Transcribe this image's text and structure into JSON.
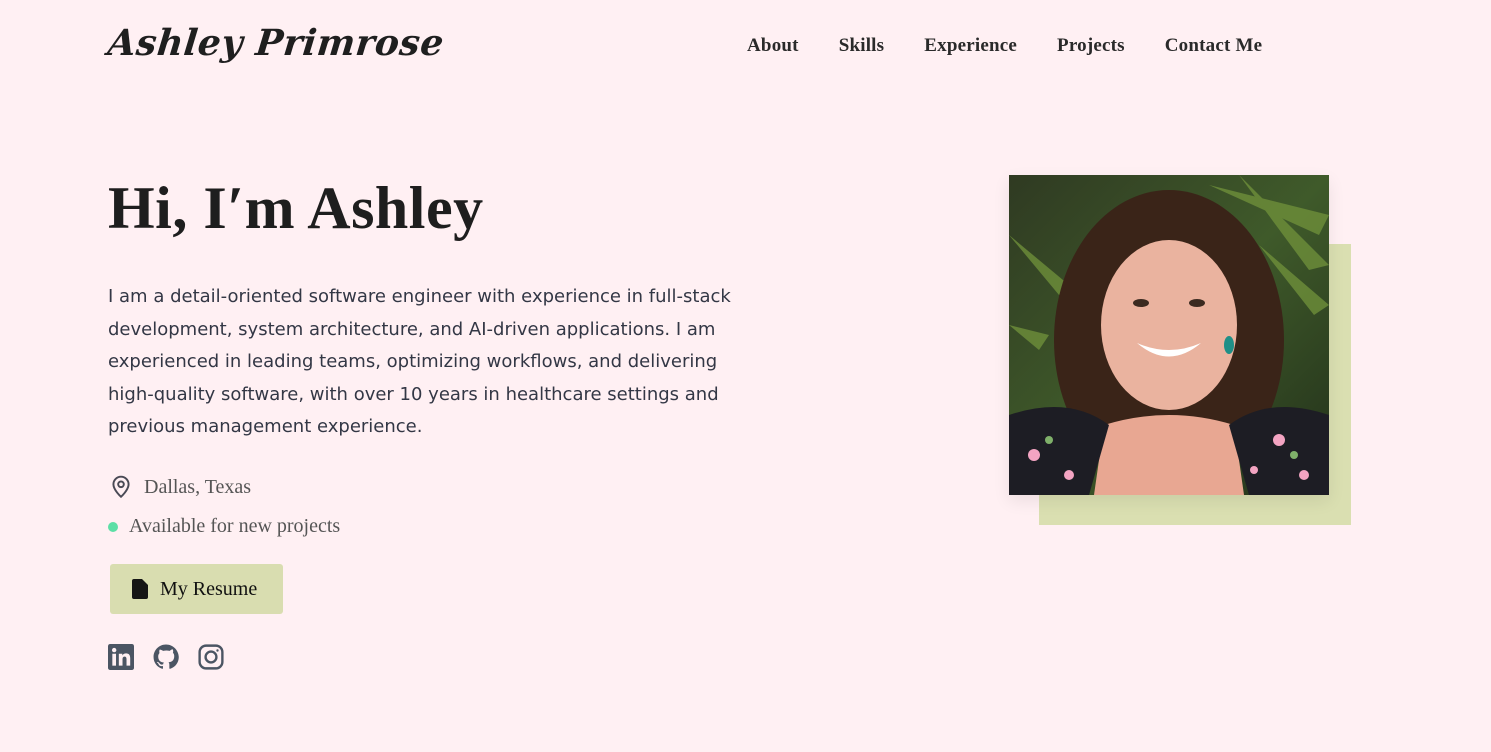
{
  "header": {
    "logo": "Ashley Primrose",
    "nav": [
      "About",
      "Skills",
      "Experience",
      "Projects",
      "Contact Me"
    ]
  },
  "hero": {
    "title": "Hi, I′m Ashley",
    "bio": "I am a detail-oriented software engineer with experience in full-stack development, system architecture, and AI-driven applications. I am experienced in leading teams, optimizing workflows, and delivering high-quality software, with over 10 years in healthcare settings and previous management experience.",
    "location": "Dallas, Texas",
    "availability": "Available for new projects",
    "resume_label": "My Resume",
    "socials": [
      {
        "icon": "linkedin-icon"
      },
      {
        "icon": "github-icon"
      },
      {
        "icon": "instagram-icon"
      }
    ],
    "photo": {
      "accent_color": "#dadfb1"
    }
  },
  "colors": {
    "background": "#fff0f3",
    "accent": "#d9ddb0",
    "available_dot": "#5ddfa6",
    "text": "#1e1e1e"
  }
}
